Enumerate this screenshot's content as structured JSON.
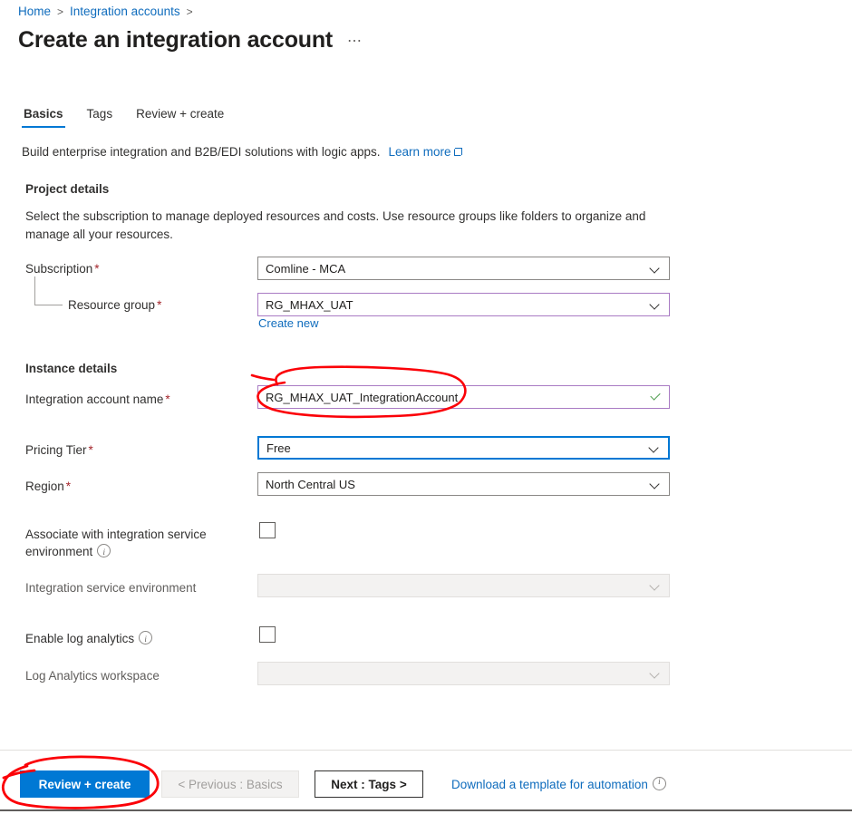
{
  "breadcrumb": {
    "items": [
      "Home",
      "Integration accounts"
    ],
    "separator": ">"
  },
  "header": {
    "title": "Create an integration account",
    "more_label": "⋯"
  },
  "tabs": [
    {
      "label": "Basics",
      "active": true
    },
    {
      "label": "Tags",
      "active": false
    },
    {
      "label": "Review + create",
      "active": false
    }
  ],
  "description": {
    "text": "Build enterprise integration and B2B/EDI solutions with logic apps.",
    "link_label": "Learn more",
    "link_icon": "external-link-icon"
  },
  "project_details": {
    "heading": "Project details",
    "subtext": "Select the subscription to manage deployed resources and costs. Use resource groups like folders to organize and manage all your resources.",
    "subscription": {
      "label": "Subscription",
      "required": "*",
      "value": "Comline - MCA",
      "icon": "chevron-down-icon"
    },
    "resource_group": {
      "label": "Resource group",
      "required": "*",
      "value": "RG_MHAX_UAT",
      "icon": "chevron-down-icon",
      "border_color": "#a97bc4",
      "create_new_label": "Create new"
    }
  },
  "instance_details": {
    "heading": "Instance details",
    "account_name": {
      "label": "Integration account name",
      "required": "*",
      "value": "RG_MHAX_UAT_IntegrationAccount",
      "icon": "checkmark-icon",
      "border_color": "#a97bc4",
      "valid_color": "#4a9b4a"
    },
    "pricing_tier": {
      "label": "Pricing Tier",
      "required": "*",
      "value": "Free",
      "icon": "chevron-down-icon",
      "border_color": "#0078d4"
    },
    "region": {
      "label": "Region",
      "required": "*",
      "value": "North Central US",
      "icon": "chevron-down-icon"
    },
    "associate_ise": {
      "label": "Associate with integration service environment",
      "info_icon": "info-icon",
      "checked": false
    },
    "ise_select": {
      "label": "Integration service environment",
      "value": "",
      "icon": "chevron-down-icon",
      "disabled": true
    },
    "enable_log_analytics": {
      "label": "Enable log analytics",
      "info_icon": "info-icon",
      "checked": false
    },
    "log_analytics_workspace": {
      "label": "Log Analytics workspace",
      "value": "",
      "icon": "chevron-down-icon",
      "disabled": true
    }
  },
  "footer": {
    "review_create_label": "Review + create",
    "previous_label": "< Previous : Basics",
    "next_label": "Next : Tags >",
    "download_label": "Download a template for automation",
    "download_info_icon": "info-icon",
    "primary_color": "#0078d4"
  },
  "annotations": {
    "color": "#fb0007",
    "shapes": [
      "circle-around-account-name-field",
      "circle-around-review-create-button"
    ]
  }
}
